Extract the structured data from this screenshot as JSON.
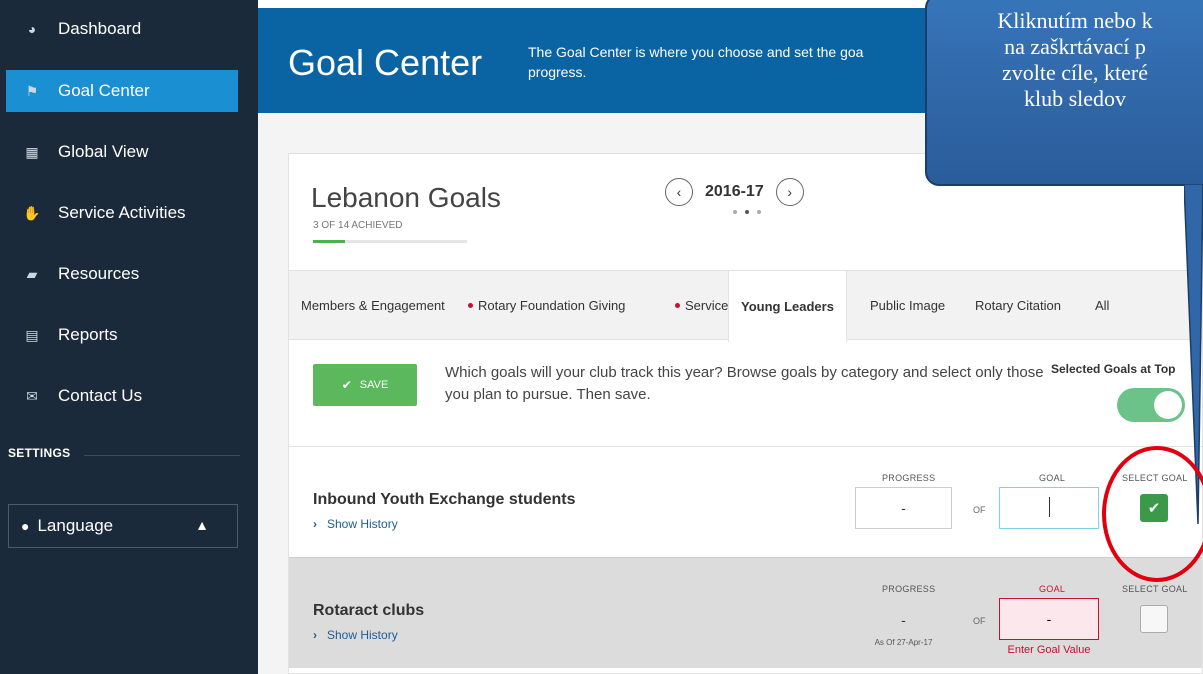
{
  "sidebar": {
    "items": [
      {
        "label": "Dashboard",
        "icon": "pie-chart-icon"
      },
      {
        "label": "Goal Center",
        "icon": "flag-icon",
        "active": true
      },
      {
        "label": "Global View",
        "icon": "grid-icon"
      },
      {
        "label": "Service Activities",
        "icon": "handshake-icon"
      },
      {
        "label": "Resources",
        "icon": "book-icon"
      },
      {
        "label": "Reports",
        "icon": "document-icon"
      },
      {
        "label": "Contact Us",
        "icon": "envelope-icon"
      }
    ],
    "settings_label": "SETTINGS",
    "language_label": "Language"
  },
  "header": {
    "title": "Goal Center",
    "description": "The Goal Center is where you choose and set the goa progress."
  },
  "club": {
    "title": "Lebanon Goals",
    "achieved": "3 OF 14 ACHIEVED",
    "achieved_fraction": 0.21,
    "year": "2016-17"
  },
  "tabs": [
    {
      "label": "Members & Engagement",
      "marked": false
    },
    {
      "label": "Rotary Foundation Giving",
      "marked": true
    },
    {
      "label": "Service",
      "marked": true
    },
    {
      "label": "Young Leaders",
      "marked": false,
      "active": true
    },
    {
      "label": "Public Image",
      "marked": false
    },
    {
      "label": "Rotary Citation",
      "marked": false
    },
    {
      "label": "All",
      "marked": false
    }
  ],
  "toolbar": {
    "save_label": "SAVE",
    "instructions": "Which goals will your club track this year? Browse goals by category and select only those you plan to pursue. Then save.",
    "selected_top_label": "Selected Goals at Top",
    "selected_top_on": true
  },
  "columns": {
    "progress": "PROGRESS",
    "goal": "GOAL",
    "select": "SELECT GOAL",
    "of": "OF"
  },
  "goals": [
    {
      "name": "Inbound Youth Exchange students",
      "history_label": "Show History",
      "progress": "-",
      "goal_value": "",
      "selected": true
    },
    {
      "name": "Rotaract clubs",
      "history_label": "Show History",
      "progress": "-",
      "as_of": "As Of 27-Apr-17",
      "goal_value": "-",
      "error": "Enter Goal Value",
      "selected": false
    }
  ],
  "callout": {
    "lines": [
      "Kliknutím nebo k",
      "na zaškrtávací p",
      "zvolte cíle, které",
      "klub sledov"
    ]
  },
  "colors": {
    "sidebar": "#1b2a3a",
    "active": "#1a8fd1",
    "header": "#0a63a2",
    "save": "#5cb85c",
    "error": "#c8102e"
  }
}
